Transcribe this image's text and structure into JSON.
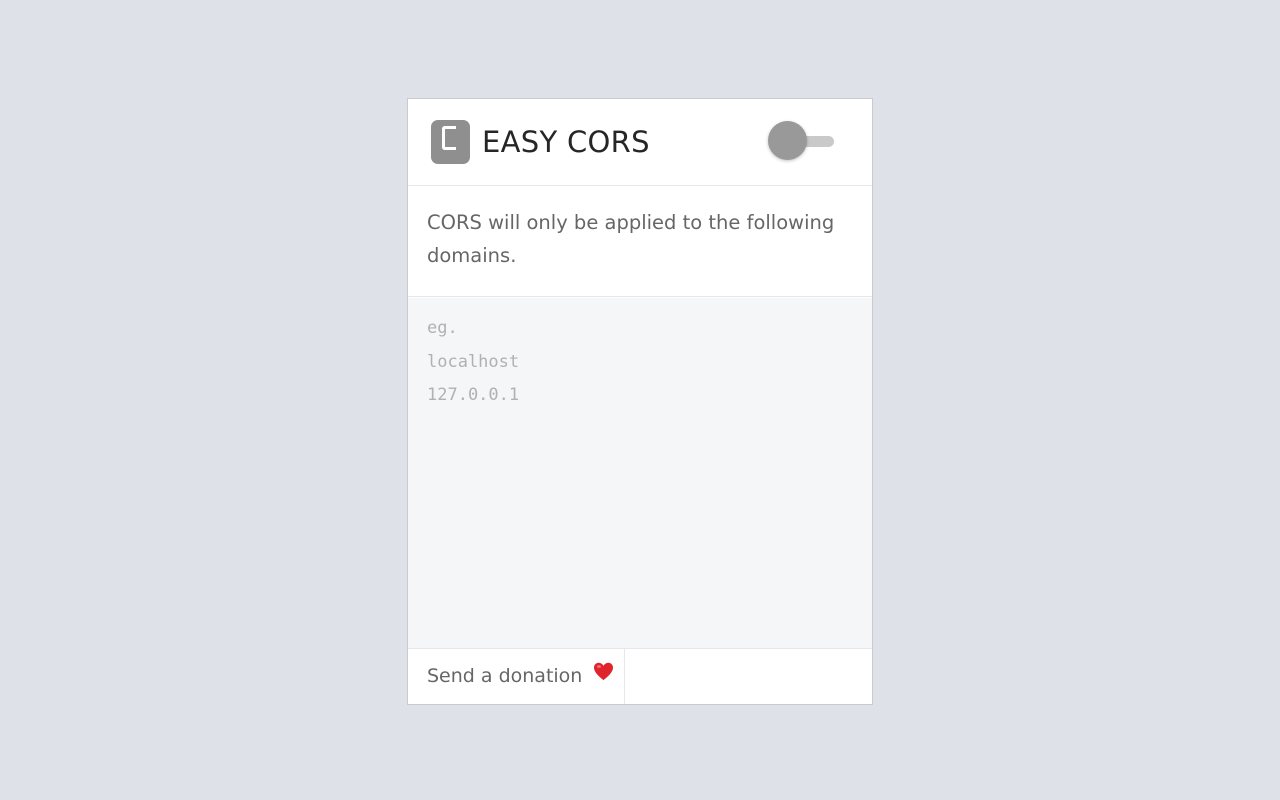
{
  "app": {
    "title": "EASY CORS",
    "toggle_state": "off"
  },
  "description": "CORS will only be applied to the following domains.",
  "domains_field": {
    "value": "",
    "placeholder": "eg.\nlocalhost\n127.0.0.1"
  },
  "footer": {
    "donate_label": "Send a donation",
    "donate_icon": "heart-icon"
  },
  "colors": {
    "logo": "#8f8f8f",
    "toggle_knob": "#999999",
    "toggle_track": "#c9c9c9",
    "heart": "#e0242c"
  }
}
